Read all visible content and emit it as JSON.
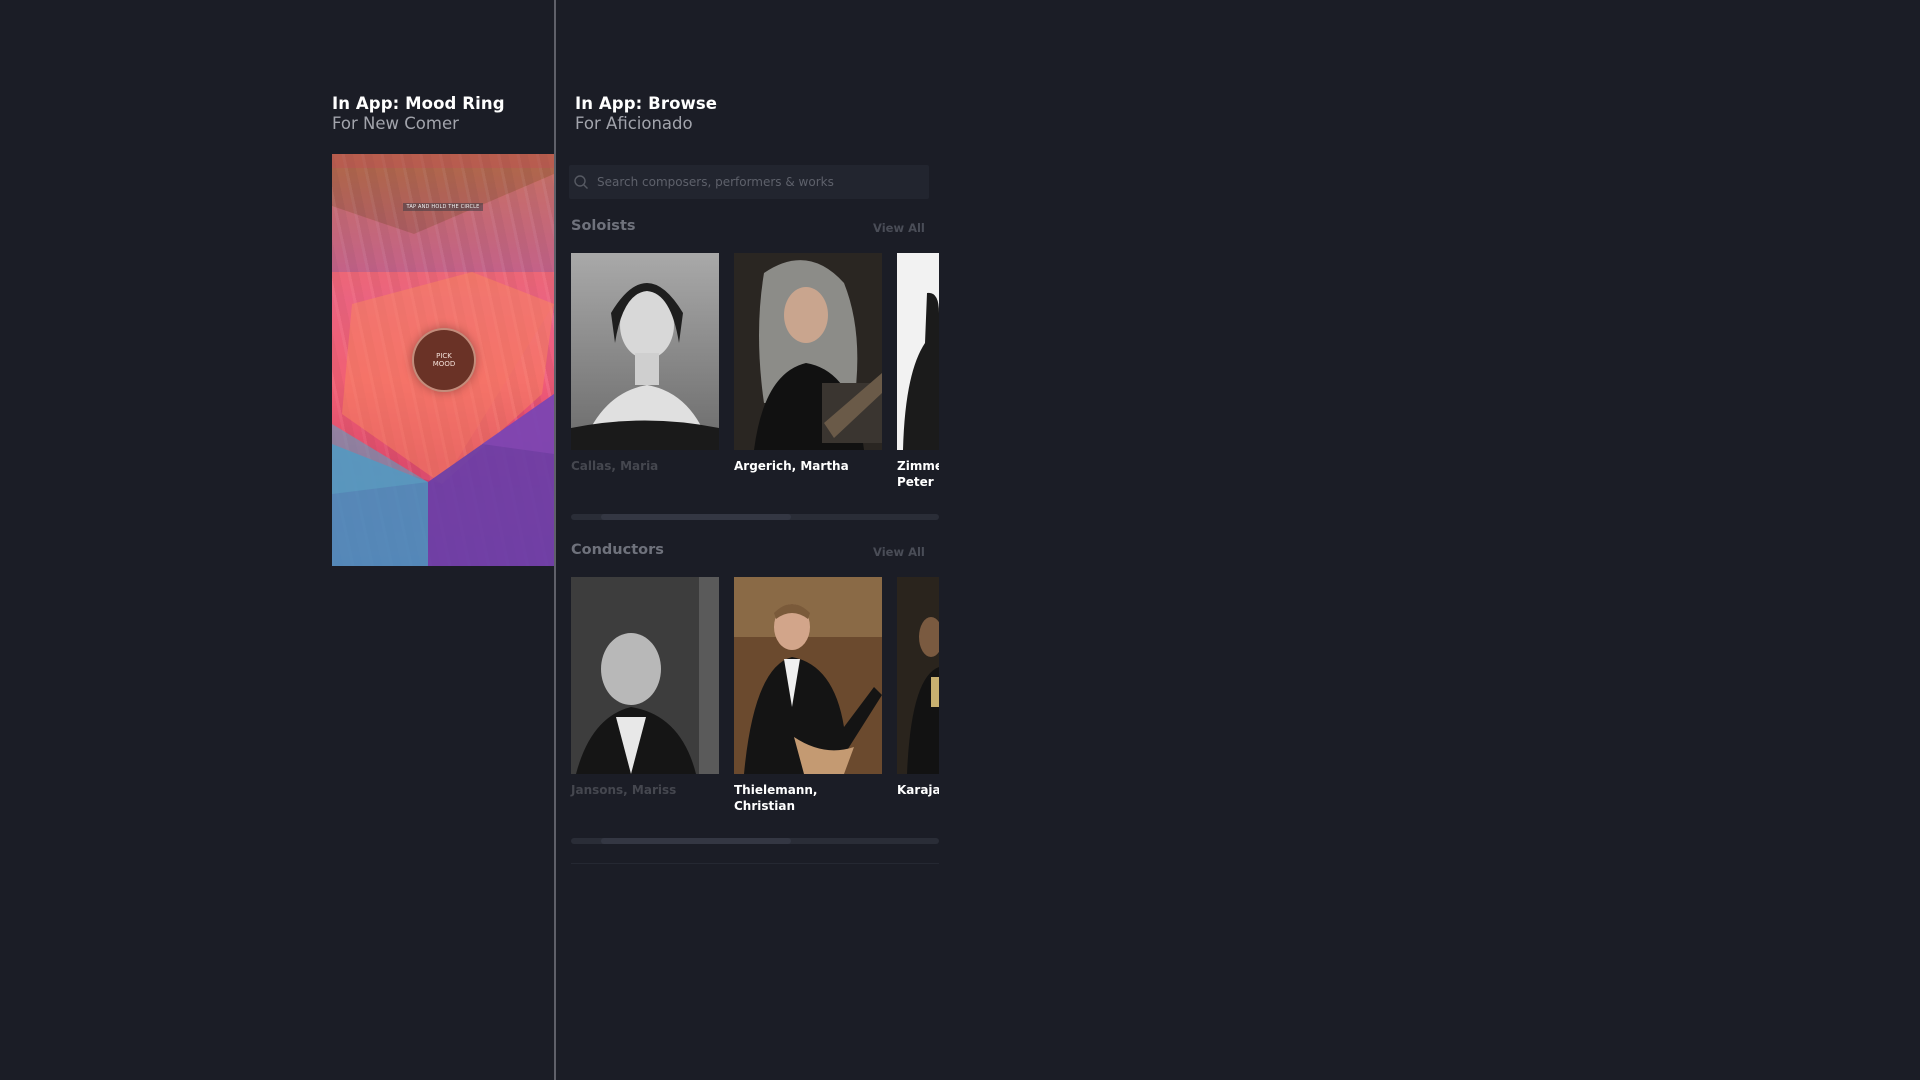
{
  "mood_section": {
    "title": "In App: Mood Ring",
    "subtitle": "For New Comer",
    "caption": "TAP AND HOLD THE CIRCLE",
    "button_line1": "PICK",
    "button_line2": "MOOD"
  },
  "browse_section": {
    "title": "In App: Browse",
    "subtitle": "For Aficionado",
    "search_placeholder": "Search composers, performers & works",
    "soloists": {
      "title": "Soloists",
      "view_all": "View All",
      "items": [
        {
          "name": "Callas, Maria"
        },
        {
          "name": "Argerich, Martha"
        },
        {
          "name": "Zimme\nPeter"
        }
      ]
    },
    "conductors": {
      "title": "Conductors",
      "view_all": "View All",
      "items": [
        {
          "name": "Jansons, Mariss"
        },
        {
          "name": "Thielemann, Christian"
        },
        {
          "name": "Karajan"
        }
      ]
    }
  },
  "colors": {
    "background": "#1b1d26",
    "divider": "#5f6069",
    "mood_orange": "#f07e3d",
    "mood_pink": "#f15c78",
    "mood_blue": "#4a8fbf",
    "mood_purple": "#6a3fa8"
  }
}
